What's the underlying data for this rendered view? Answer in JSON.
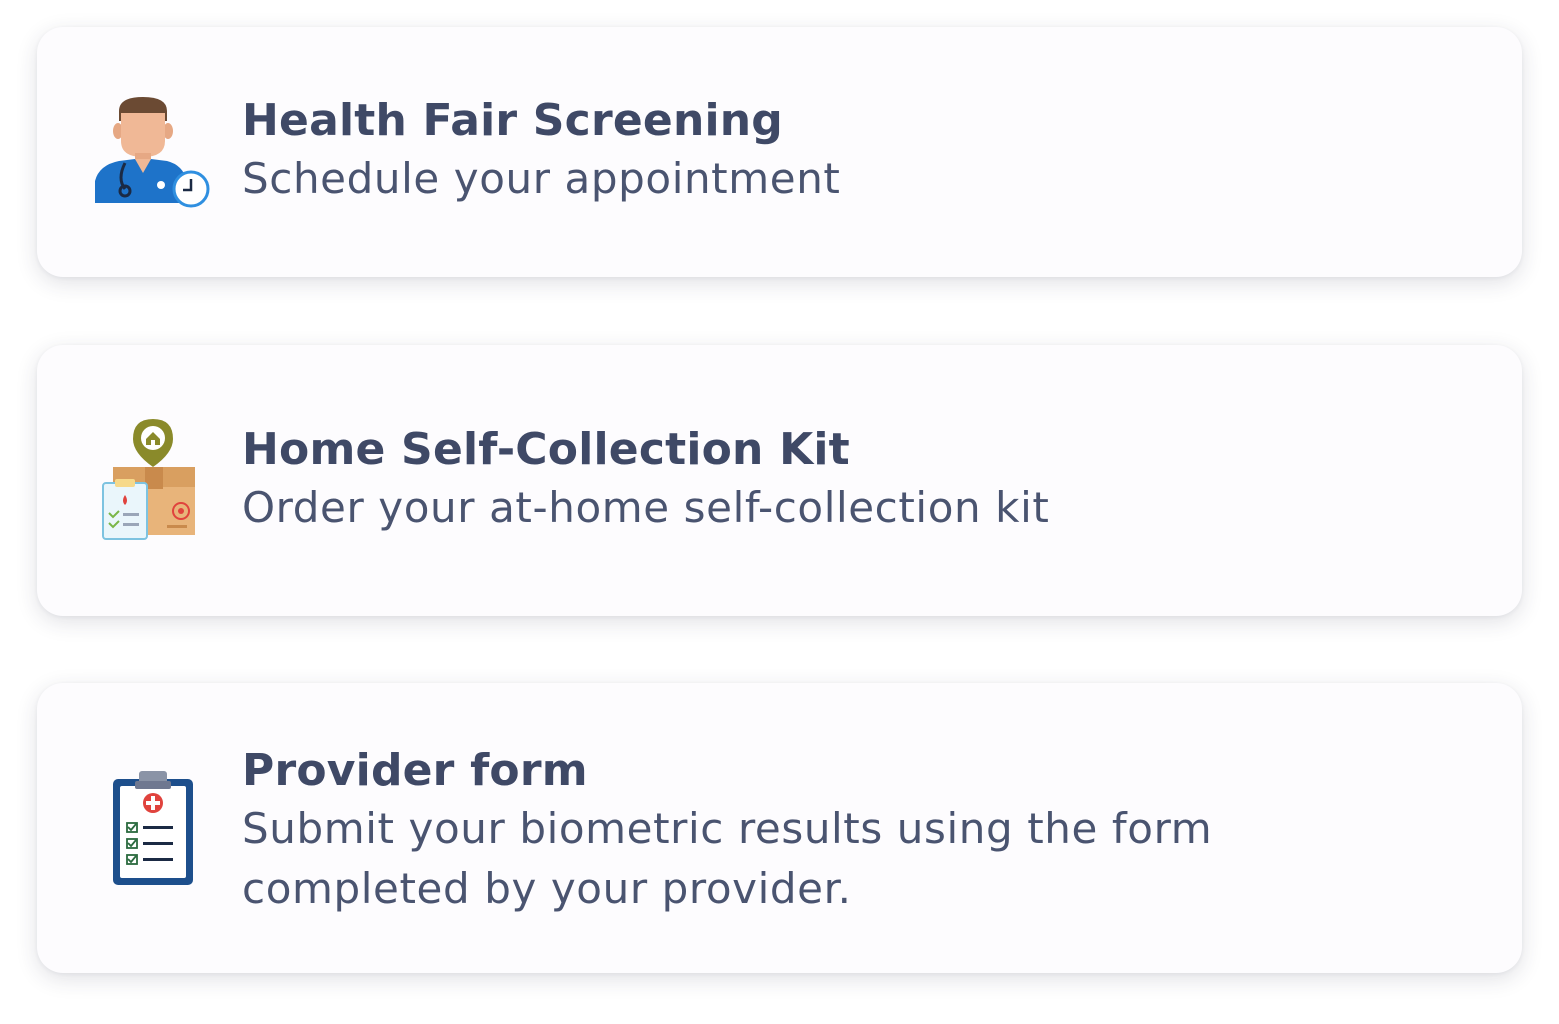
{
  "cards": [
    {
      "title": "Health Fair Screening",
      "description": "Schedule your appointment",
      "icon": "doctor-with-clock-icon"
    },
    {
      "title": "Home Self-Collection Kit",
      "description": "Order your at-home self-collection kit",
      "icon": "home-kit-package-icon"
    },
    {
      "title": "Provider form",
      "description": "Submit your biometric results using the form completed by your provider.",
      "icon": "medical-clipboard-icon"
    }
  ],
  "colors": {
    "title": "#3f4966",
    "description": "#4a5470",
    "card_background": "#fdfcfe",
    "doctor_blue": "#1e73c9",
    "clock_blue": "#2f8fe0",
    "pin_olive": "#8a8a2a",
    "box_tan": "#e8b47a",
    "clipboard_navy": "#1d4f8c",
    "cross_red": "#e0433d"
  }
}
